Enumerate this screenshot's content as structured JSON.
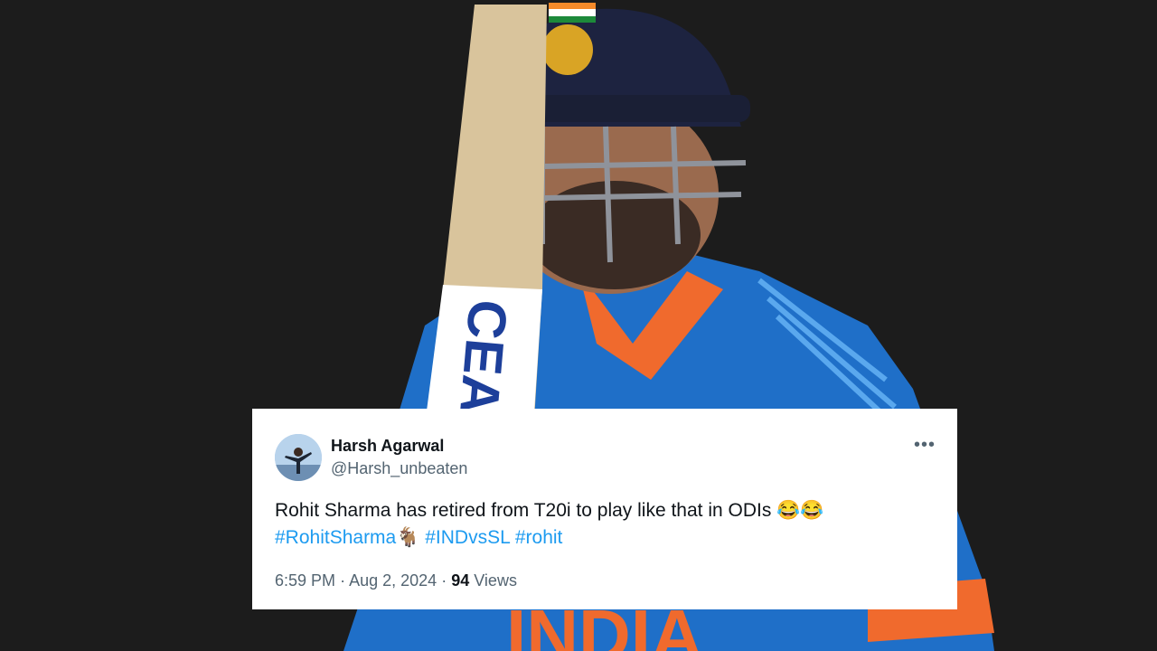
{
  "tweet": {
    "author_name": "Harsh Agarwal",
    "author_handle": "@Harsh_unbeaten",
    "more_label": "•••",
    "text": "Rohit Sharma has retired from T20i to play like that in ODIs 😂😂",
    "hashtags": [
      "#RohitSharma🐐",
      "#INDvsSL",
      "#rohit"
    ],
    "time": "6:59 PM",
    "sep1": "·",
    "date": "Aug 2, 2024",
    "sep2": "·",
    "views_count": "94",
    "views_label": "Views"
  },
  "photo": {
    "bat_brand": "CEAT",
    "jersey_text": "INDIA"
  },
  "colors": {
    "link": "#1d9bf0",
    "jersey": "#1f6fc8",
    "orange": "#f06a2d",
    "helmet": "#1d2340"
  }
}
